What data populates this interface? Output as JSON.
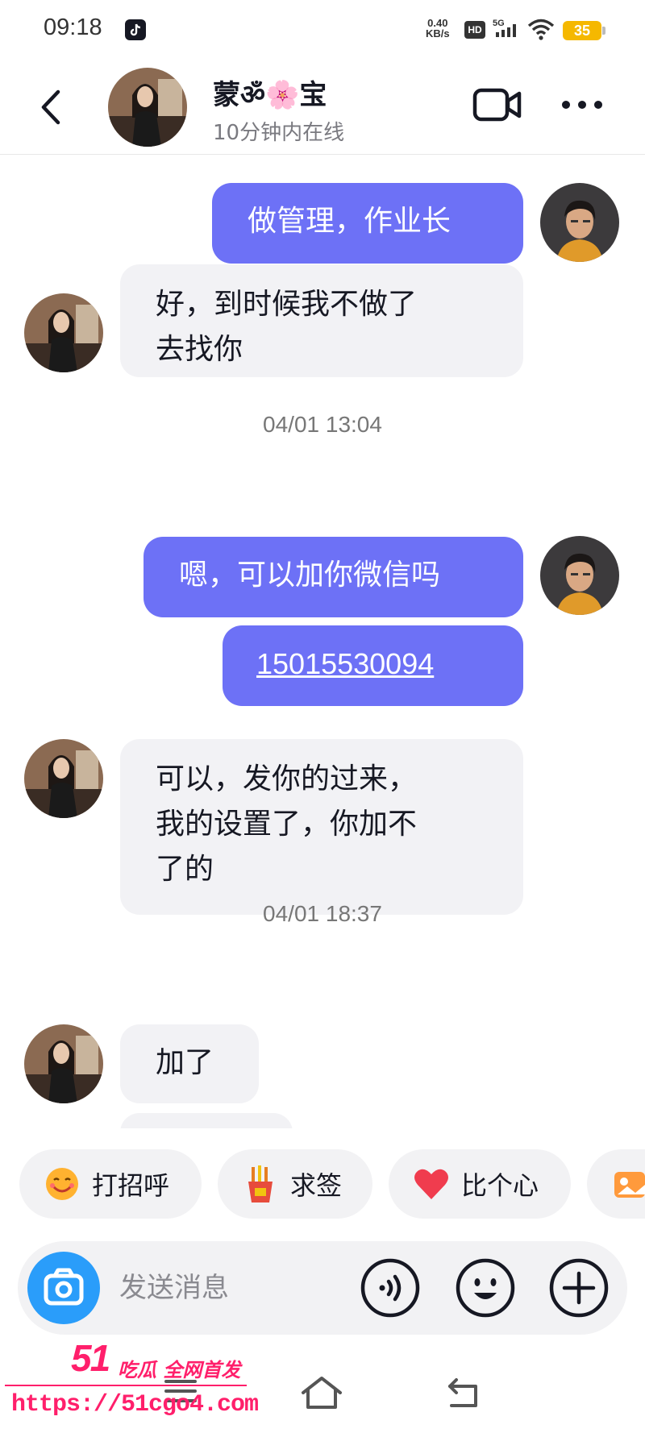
{
  "status_bar": {
    "time": "09:18",
    "net_speed_value": "0.40",
    "net_speed_unit": "KB/s",
    "hd_label": "HD",
    "network": "5G",
    "battery": "35"
  },
  "header": {
    "contact_name": "蒙ॐ🌸宝",
    "online_status": "10分钟内在线"
  },
  "messages": [
    {
      "side": "out",
      "text": "做管理，作业长"
    },
    {
      "side": "in",
      "text": "好，到时候我不做了去找你"
    },
    {
      "timestamp": "04/01 13:04"
    },
    {
      "side": "out",
      "text": "嗯，可以加你微信吗"
    },
    {
      "side": "out",
      "text": "15015530094",
      "link": true
    },
    {
      "side": "in",
      "text": "可以，发你的过来，我的设置了，你加不了的"
    },
    {
      "timestamp": "04/01 18:37"
    },
    {
      "side": "in",
      "text": "加了"
    }
  ],
  "bubbles": {
    "m1": "做管理，作业长",
    "m2_line1": "好，到时候我不做了",
    "m2_line2": "去找你",
    "ts1": "04/01 13:04",
    "m3": "嗯，可以加你微信吗",
    "m4": "15015530094",
    "m5_line1": "可以，发你的过来，",
    "m5_line2": "我的设置了，你加不",
    "m5_line3": "了的",
    "ts2": "04/01 18:37",
    "m6": "加了"
  },
  "quick_actions": [
    {
      "label": "打招呼",
      "icon": "smile-face-icon"
    },
    {
      "label": "求签",
      "icon": "fortune-sticks-icon"
    },
    {
      "label": "比个心",
      "icon": "heart-icon"
    }
  ],
  "input": {
    "placeholder": "发送消息"
  },
  "watermark": {
    "brand": "51",
    "title": "吃瓜 全网首发",
    "url": "https://51cgo4.com"
  },
  "colors": {
    "outgoing_bubble": "#6d71f6",
    "incoming_bubble": "#f2f2f5",
    "camera_button": "#2a9dfa",
    "battery": "#f5b800",
    "watermark": "#ff1f6b"
  }
}
